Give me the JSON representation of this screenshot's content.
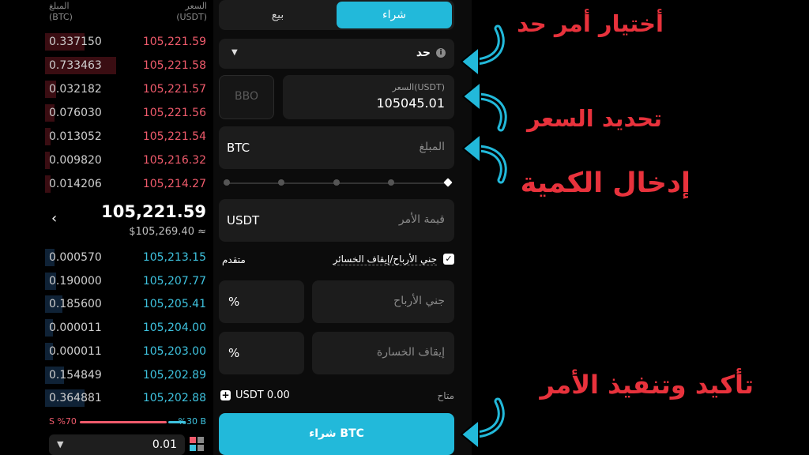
{
  "orderbook": {
    "header": {
      "qty_label": "المبلغ",
      "qty_unit": "(BTC)",
      "price_label": "السعر",
      "price_unit": "(USDT)"
    },
    "asks": [
      {
        "qty": "0.337150",
        "price": "105,221.59",
        "depth": 0.42
      },
      {
        "qty": "0.733463",
        "price": "105,221.58",
        "depth": 0.75
      },
      {
        "qty": "0.032182",
        "price": "105,221.57",
        "depth": 0.12
      },
      {
        "qty": "0.076030",
        "price": "105,221.56",
        "depth": 0.1
      },
      {
        "qty": "0.013052",
        "price": "105,221.54",
        "depth": 0.06
      },
      {
        "qty": "0.009820",
        "price": "105,216.32",
        "depth": 0.05
      },
      {
        "qty": "0.014206",
        "price": "105,214.27",
        "depth": 0.06
      }
    ],
    "mid": {
      "chevron": "‹",
      "last_price": "105,221.59",
      "usd_price": "$105,269.40 ≈"
    },
    "bids": [
      {
        "qty": "0.000570",
        "price": "105,213.15",
        "depth": 0.1
      },
      {
        "qty": "0.190000",
        "price": "105,207.77",
        "depth": 0.12
      },
      {
        "qty": "0.185600",
        "price": "105,205.41",
        "depth": 0.18
      },
      {
        "qty": "0.000011",
        "price": "105,204.00",
        "depth": 0.08
      },
      {
        "qty": "0.000011",
        "price": "105,203.00",
        "depth": 0.08
      },
      {
        "qty": "0.154849",
        "price": "105,202.89",
        "depth": 0.2
      },
      {
        "qty": "0.364881",
        "price": "105,202.88",
        "depth": 0.42
      }
    ],
    "ratio": {
      "sell": "S %70",
      "buy": "%30 B",
      "sell_fraction": 0.7,
      "buy_fraction": 0.3
    },
    "tick": {
      "value": "0.01"
    }
  },
  "form": {
    "tabs": {
      "sell": "بيع",
      "buy": "شراء"
    },
    "order_type": {
      "label": "حد",
      "info": "i"
    },
    "bbo": "BBO",
    "price": {
      "label": "السعر(USDT)",
      "value": "105045.01"
    },
    "amount": {
      "unit": "BTC",
      "placeholder": "المبلغ"
    },
    "order_value": {
      "unit": "USDT",
      "placeholder": "قيمة الأمر"
    },
    "tpsl": {
      "advanced": "متقدم",
      "label": "جني الأرباح/إيقاف الخسائر",
      "checked": true
    },
    "take_profit": {
      "pct": "%",
      "placeholder": "جني الأرباح"
    },
    "stop_loss": {
      "pct": "%",
      "placeholder": "إيقاف الخسارة"
    },
    "available": {
      "balance": "USDT 0.00",
      "label": "متاح"
    },
    "submit": "شراء BTC"
  },
  "annotations": {
    "choose_limit": "أختيار أمر حد",
    "set_price": "تحديد السعر",
    "enter_qty": "إدخال الكمية",
    "confirm": "تأكيد وتنفيذ الأمر"
  },
  "colors": {
    "accent": "#22b9da",
    "ask": "#f05b6c",
    "bid": "#3ec2de",
    "annotation": "#e8323c"
  }
}
